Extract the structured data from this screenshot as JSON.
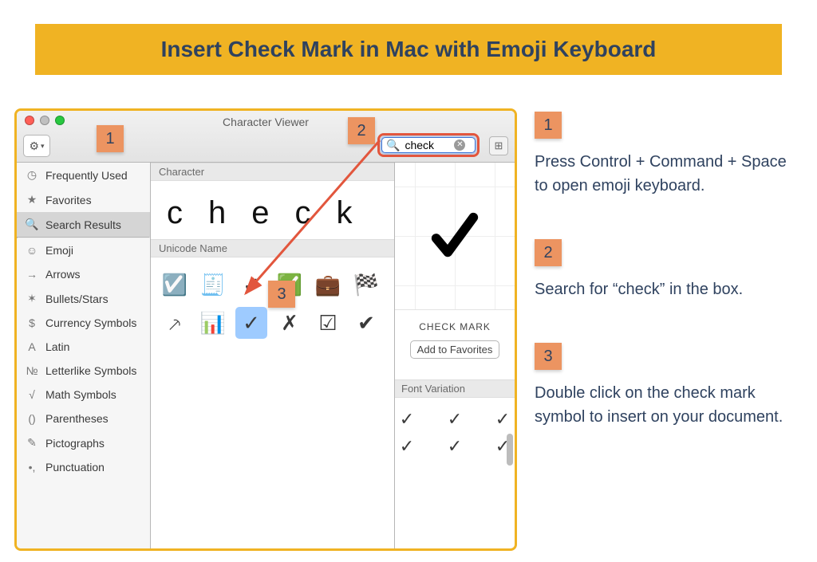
{
  "title": "Insert Check Mark in Mac with Emoji Keyboard",
  "window": {
    "title": "Character Viewer",
    "gear_icon": "⚙",
    "grid_icon": "⊞",
    "search": {
      "value": "check",
      "icon": "search",
      "clear": "clear"
    },
    "sidebar": {
      "items": [
        {
          "label": "Frequently Used",
          "icon": "◷"
        },
        {
          "label": "Favorites",
          "icon": "★"
        },
        {
          "label": "Search Results",
          "icon": "🔍",
          "selected": true
        },
        {
          "sep": true
        },
        {
          "label": "Emoji",
          "icon": "☺"
        },
        {
          "label": "Arrows",
          "icon": "→"
        },
        {
          "label": "Bullets/Stars",
          "icon": "✶"
        },
        {
          "label": "Currency Symbols",
          "icon": "$"
        },
        {
          "label": "Latin",
          "icon": "A"
        },
        {
          "label": "Letterlike Symbols",
          "icon": "№"
        },
        {
          "label": "Math Symbols",
          "icon": "√"
        },
        {
          "label": "Parentheses",
          "icon": "()"
        },
        {
          "label": "Pictographs",
          "icon": "✎"
        },
        {
          "label": "Punctuation",
          "icon": "•,"
        }
      ]
    },
    "character_header": "Character",
    "character_display": "check",
    "unicode_header": "Unicode Name",
    "grid": [
      "☑️",
      "🧾",
      "✓",
      "✅",
      "💼",
      "🏁",
      "⸕",
      "📊",
      "✓",
      "✗",
      "☑",
      "✔"
    ],
    "grid_selected_index": 8,
    "info": {
      "name": "CHECK MARK",
      "add_favorites": "Add to Favorites",
      "fv_header": "Font Variation",
      "fv_variants": [
        "✓",
        "✓",
        "✓",
        "✓",
        "✓",
        "✓"
      ]
    }
  },
  "badges": {
    "b1": "1",
    "b2": "2",
    "b3": "3"
  },
  "instructions": {
    "step1": "Press Control + Command + Space to open emoji keyboard.",
    "step2": "Search for “check” in the box.",
    "step3": "Double click on the check mark symbol to insert on your document."
  }
}
